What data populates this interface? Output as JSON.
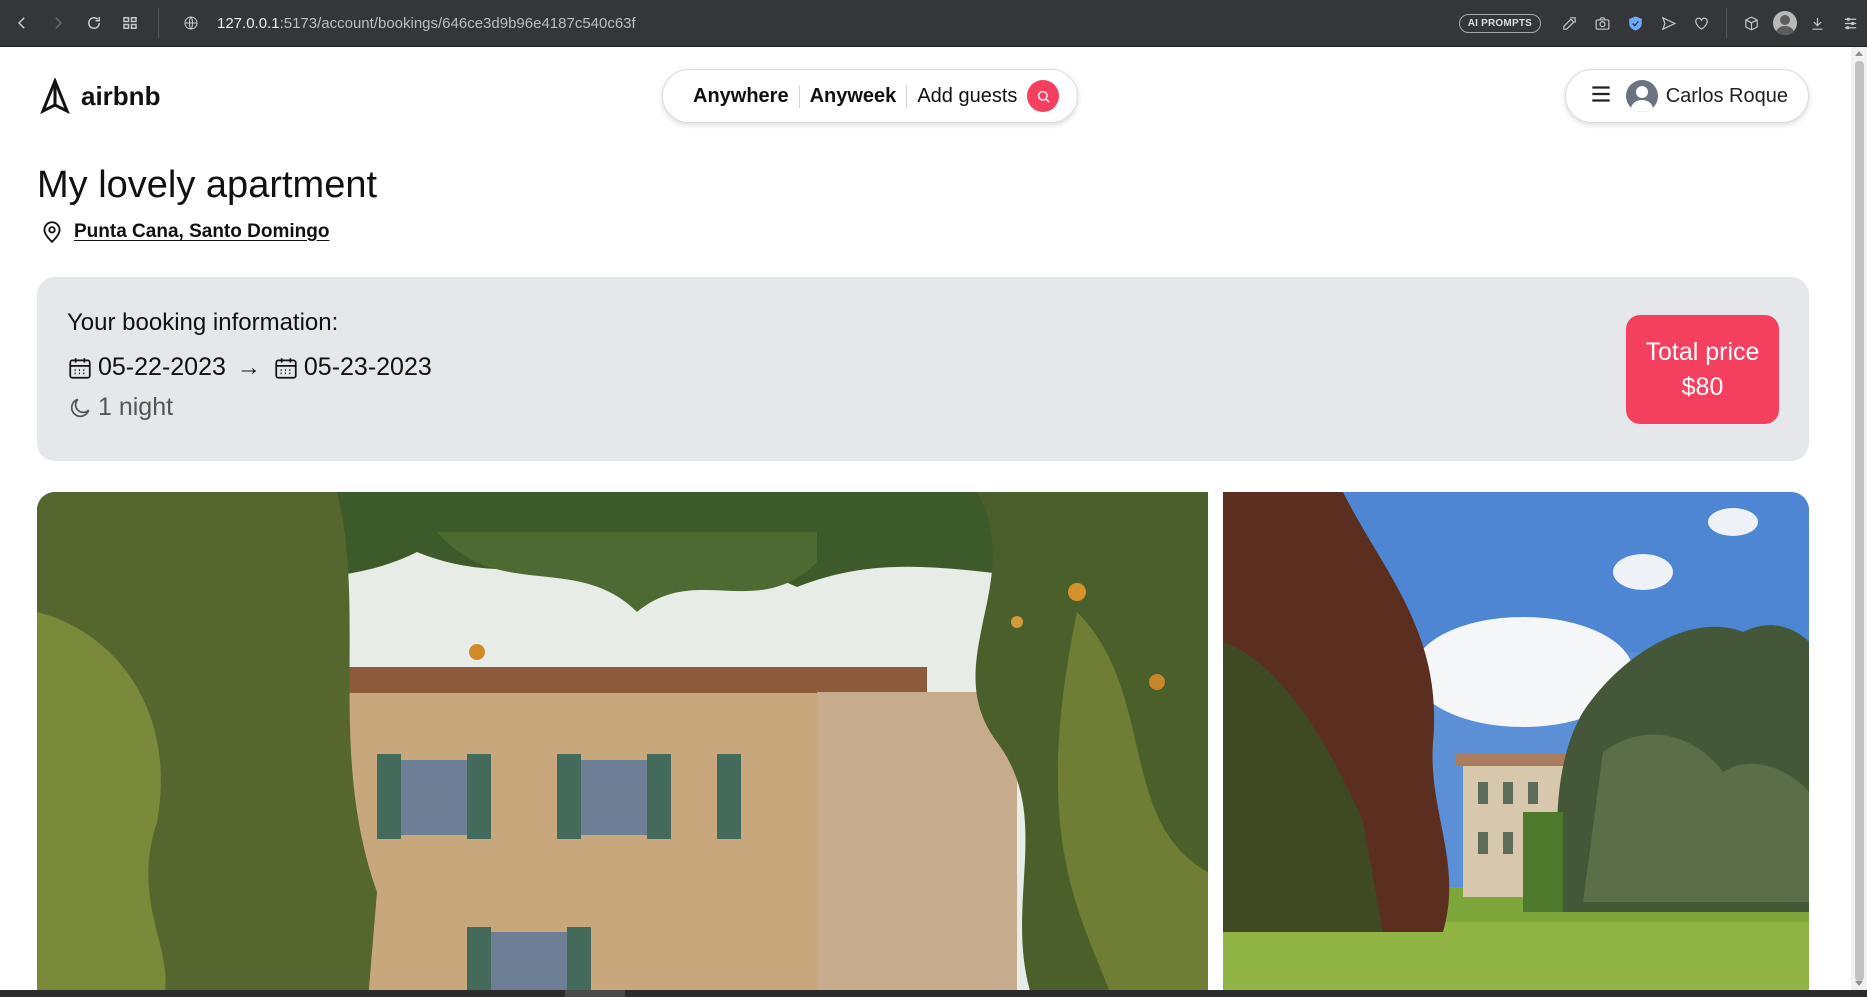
{
  "browser": {
    "url_host": "127.0.0.1",
    "url_path": ":5173/account/bookings/646ce3d9b96e4187c540c63f",
    "ai_prompts_label": "AI PROMPTS"
  },
  "header": {
    "logo_text": "airbnb",
    "search": {
      "where": "Anywhere",
      "when": "Anyweek",
      "guests": "Add guests"
    },
    "user_name": "Carlos Roque"
  },
  "place": {
    "title": "My lovely apartment",
    "address": "Punta Cana, Santo Domingo"
  },
  "booking": {
    "heading": "Your booking information:",
    "check_in": "05-22-2023",
    "arrow": "→",
    "check_out": "05-23-2023",
    "nights": "1 night",
    "price_label": "Total price",
    "price_value": "$80"
  },
  "colors": {
    "accent": "#f43f5e",
    "panel_bg": "#e5e7eb",
    "chrome_bg": "#35363a"
  }
}
